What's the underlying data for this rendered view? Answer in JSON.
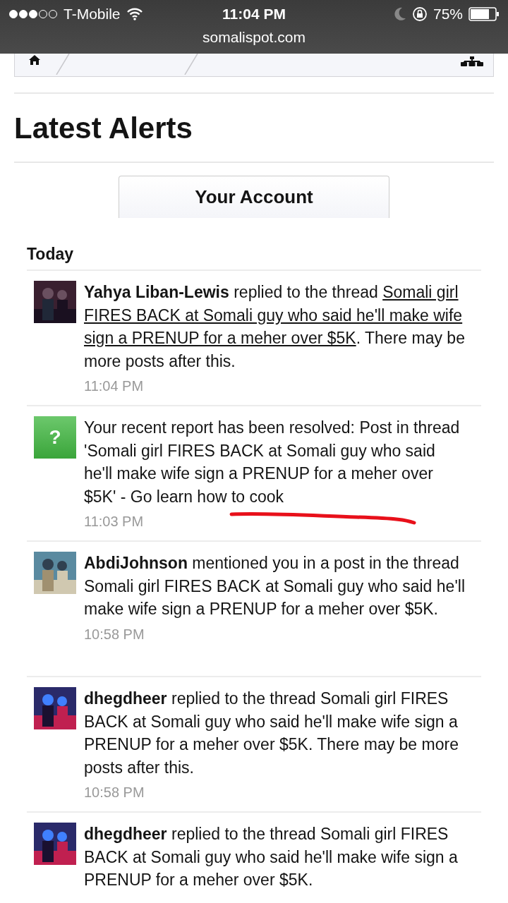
{
  "status_bar": {
    "carrier": "T-Mobile",
    "time": "11:04 PM",
    "battery": "75%",
    "url": "somalispot.com"
  },
  "heading": "Latest Alerts",
  "tabs": [
    {
      "label": "Your Account",
      "selected": true
    }
  ],
  "section": "Today",
  "alerts": [
    {
      "kind": "user",
      "segments": [
        {
          "kind": "user",
          "text": "Yahya Liban-Lewis"
        },
        {
          "kind": "plain",
          "text": " replied to the thread "
        },
        {
          "kind": "link",
          "text": "Somali girl FIRES BACK at Somali guy who said he'll make wife sign a PRENUP for a meher over $5K"
        },
        {
          "kind": "plain",
          "text": ". There may be more posts after this."
        }
      ],
      "time": "11:04 PM"
    },
    {
      "kind": "report",
      "glyph": "?",
      "segments": [
        {
          "kind": "plain",
          "text": "Your recent report has been resolved: Post in thread 'Somali girl FIRES BACK at Somali guy who said he'll make wife sign a PRENUP for a meher over $5K' - Go learn how to cook"
        }
      ],
      "time": "11:03 PM",
      "scribble": {
        "kind": "underline",
        "color": "#e8101a"
      }
    },
    {
      "kind": "user",
      "segments": [
        {
          "kind": "user",
          "text": "AbdiJohnson"
        },
        {
          "kind": "plain",
          "text": " mentioned you in a post in the thread Somali girl FIRES BACK at Somali guy who said he'll make wife sign a PRENUP for a meher over $5K."
        }
      ],
      "time": "10:58 PM"
    },
    {
      "kind": "user",
      "segments": [
        {
          "kind": "user",
          "text": "dhegdheer"
        },
        {
          "kind": "plain",
          "text": " replied to the thread Somali girl FIRES BACK at Somali guy who said he'll make wife sign a PRENUP for a meher over $5K. There may be more posts after this."
        }
      ],
      "time": "10:58 PM"
    },
    {
      "kind": "user",
      "segments": [
        {
          "kind": "user",
          "text": "dhegdheer"
        },
        {
          "kind": "plain",
          "text": " replied to the thread Somali girl FIRES BACK at Somali guy who said he'll make wife sign a PRENUP for a meher over $5K."
        }
      ]
    }
  ]
}
